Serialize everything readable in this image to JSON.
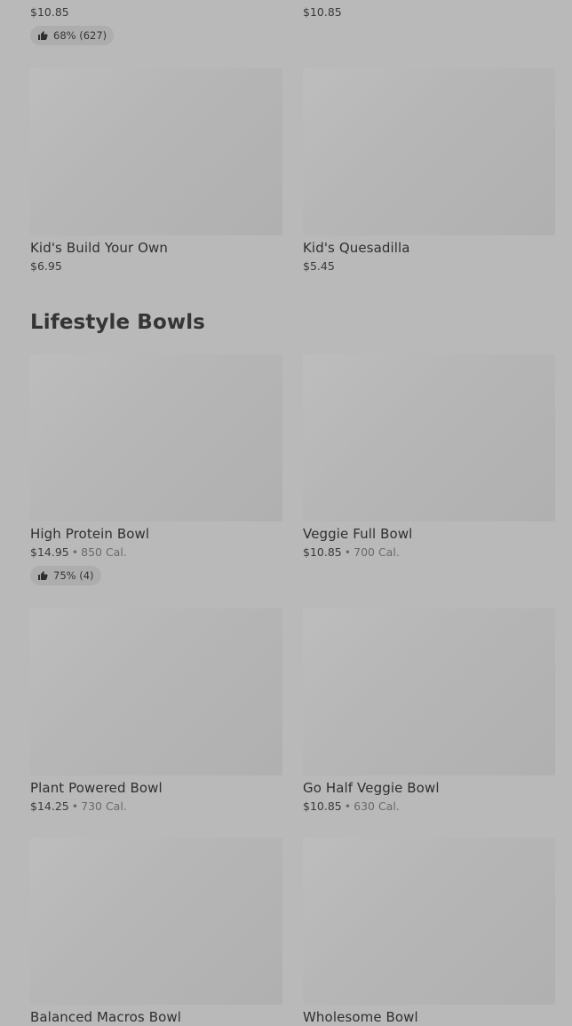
{
  "top_row": {
    "left": {
      "price": "$10.85",
      "rating": "68% (627)"
    },
    "right": {
      "price": "$10.85"
    }
  },
  "kids": [
    {
      "name": "Kid's Build Your Own",
      "price": "$6.95"
    },
    {
      "name": "Kid's Quesadilla",
      "price": "$5.45"
    }
  ],
  "lifestyle": {
    "title": "Lifestyle Bowls",
    "items": [
      {
        "name": "High Protein Bowl",
        "price": "$14.95",
        "calories": "850 Cal.",
        "rating": "75% (4)"
      },
      {
        "name": "Veggie Full Bowl",
        "price": "$10.85",
        "calories": "700 Cal."
      },
      {
        "name": "Plant Powered Bowl",
        "price": "$14.25",
        "calories": "730 Cal."
      },
      {
        "name": "Go Half Veggie Bowl",
        "price": "$10.85",
        "calories": "630 Cal."
      },
      {
        "name": "Balanced Macros Bowl"
      },
      {
        "name": "Wholesome Bowl"
      }
    ]
  },
  "separator": "•",
  "icons": {
    "rating": "thumbs-up-icon"
  },
  "colors": {
    "background": "#b9b9b9",
    "placeholder": "#b6b6b6",
    "badge": "#adadad"
  }
}
